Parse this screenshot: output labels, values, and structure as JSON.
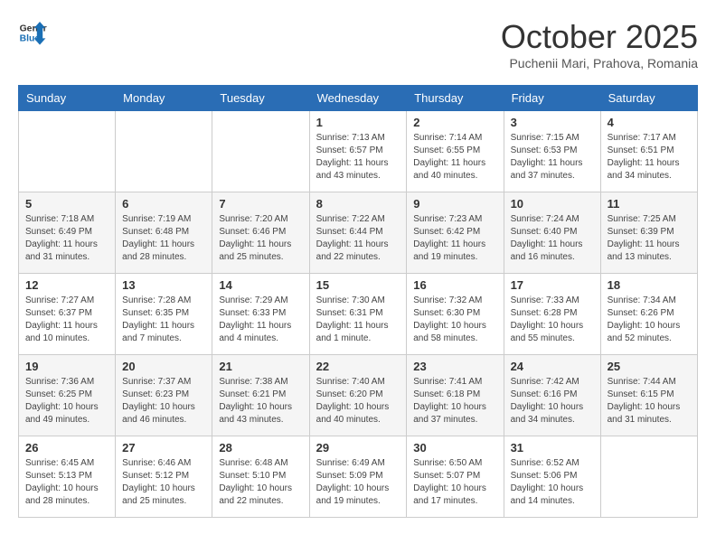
{
  "header": {
    "logo_general": "General",
    "logo_blue": "Blue",
    "month": "October 2025",
    "location": "Puchenii Mari, Prahova, Romania"
  },
  "days_of_week": [
    "Sunday",
    "Monday",
    "Tuesday",
    "Wednesday",
    "Thursday",
    "Friday",
    "Saturday"
  ],
  "weeks": [
    [
      {
        "day": "",
        "info": ""
      },
      {
        "day": "",
        "info": ""
      },
      {
        "day": "",
        "info": ""
      },
      {
        "day": "1",
        "info": "Sunrise: 7:13 AM\nSunset: 6:57 PM\nDaylight: 11 hours and 43 minutes."
      },
      {
        "day": "2",
        "info": "Sunrise: 7:14 AM\nSunset: 6:55 PM\nDaylight: 11 hours and 40 minutes."
      },
      {
        "day": "3",
        "info": "Sunrise: 7:15 AM\nSunset: 6:53 PM\nDaylight: 11 hours and 37 minutes."
      },
      {
        "day": "4",
        "info": "Sunrise: 7:17 AM\nSunset: 6:51 PM\nDaylight: 11 hours and 34 minutes."
      }
    ],
    [
      {
        "day": "5",
        "info": "Sunrise: 7:18 AM\nSunset: 6:49 PM\nDaylight: 11 hours and 31 minutes."
      },
      {
        "day": "6",
        "info": "Sunrise: 7:19 AM\nSunset: 6:48 PM\nDaylight: 11 hours and 28 minutes."
      },
      {
        "day": "7",
        "info": "Sunrise: 7:20 AM\nSunset: 6:46 PM\nDaylight: 11 hours and 25 minutes."
      },
      {
        "day": "8",
        "info": "Sunrise: 7:22 AM\nSunset: 6:44 PM\nDaylight: 11 hours and 22 minutes."
      },
      {
        "day": "9",
        "info": "Sunrise: 7:23 AM\nSunset: 6:42 PM\nDaylight: 11 hours and 19 minutes."
      },
      {
        "day": "10",
        "info": "Sunrise: 7:24 AM\nSunset: 6:40 PM\nDaylight: 11 hours and 16 minutes."
      },
      {
        "day": "11",
        "info": "Sunrise: 7:25 AM\nSunset: 6:39 PM\nDaylight: 11 hours and 13 minutes."
      }
    ],
    [
      {
        "day": "12",
        "info": "Sunrise: 7:27 AM\nSunset: 6:37 PM\nDaylight: 11 hours and 10 minutes."
      },
      {
        "day": "13",
        "info": "Sunrise: 7:28 AM\nSunset: 6:35 PM\nDaylight: 11 hours and 7 minutes."
      },
      {
        "day": "14",
        "info": "Sunrise: 7:29 AM\nSunset: 6:33 PM\nDaylight: 11 hours and 4 minutes."
      },
      {
        "day": "15",
        "info": "Sunrise: 7:30 AM\nSunset: 6:31 PM\nDaylight: 11 hours and 1 minute."
      },
      {
        "day": "16",
        "info": "Sunrise: 7:32 AM\nSunset: 6:30 PM\nDaylight: 10 hours and 58 minutes."
      },
      {
        "day": "17",
        "info": "Sunrise: 7:33 AM\nSunset: 6:28 PM\nDaylight: 10 hours and 55 minutes."
      },
      {
        "day": "18",
        "info": "Sunrise: 7:34 AM\nSunset: 6:26 PM\nDaylight: 10 hours and 52 minutes."
      }
    ],
    [
      {
        "day": "19",
        "info": "Sunrise: 7:36 AM\nSunset: 6:25 PM\nDaylight: 10 hours and 49 minutes."
      },
      {
        "day": "20",
        "info": "Sunrise: 7:37 AM\nSunset: 6:23 PM\nDaylight: 10 hours and 46 minutes."
      },
      {
        "day": "21",
        "info": "Sunrise: 7:38 AM\nSunset: 6:21 PM\nDaylight: 10 hours and 43 minutes."
      },
      {
        "day": "22",
        "info": "Sunrise: 7:40 AM\nSunset: 6:20 PM\nDaylight: 10 hours and 40 minutes."
      },
      {
        "day": "23",
        "info": "Sunrise: 7:41 AM\nSunset: 6:18 PM\nDaylight: 10 hours and 37 minutes."
      },
      {
        "day": "24",
        "info": "Sunrise: 7:42 AM\nSunset: 6:16 PM\nDaylight: 10 hours and 34 minutes."
      },
      {
        "day": "25",
        "info": "Sunrise: 7:44 AM\nSunset: 6:15 PM\nDaylight: 10 hours and 31 minutes."
      }
    ],
    [
      {
        "day": "26",
        "info": "Sunrise: 6:45 AM\nSunset: 5:13 PM\nDaylight: 10 hours and 28 minutes."
      },
      {
        "day": "27",
        "info": "Sunrise: 6:46 AM\nSunset: 5:12 PM\nDaylight: 10 hours and 25 minutes."
      },
      {
        "day": "28",
        "info": "Sunrise: 6:48 AM\nSunset: 5:10 PM\nDaylight: 10 hours and 22 minutes."
      },
      {
        "day": "29",
        "info": "Sunrise: 6:49 AM\nSunset: 5:09 PM\nDaylight: 10 hours and 19 minutes."
      },
      {
        "day": "30",
        "info": "Sunrise: 6:50 AM\nSunset: 5:07 PM\nDaylight: 10 hours and 17 minutes."
      },
      {
        "day": "31",
        "info": "Sunrise: 6:52 AM\nSunset: 5:06 PM\nDaylight: 10 hours and 14 minutes."
      },
      {
        "day": "",
        "info": ""
      }
    ]
  ]
}
